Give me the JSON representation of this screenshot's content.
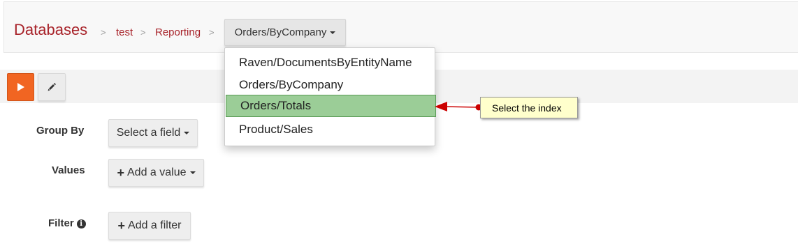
{
  "header": {
    "brand": "Databases",
    "breadcrumb": [
      {
        "label": "test"
      },
      {
        "label": "Reporting"
      }
    ],
    "separator": ">",
    "index_selector": {
      "label": "Orders/ByCompany"
    }
  },
  "dropdown": {
    "items": [
      {
        "label": "Raven/DocumentsByEntityName",
        "highlighted": false
      },
      {
        "label": "Orders/ByCompany",
        "highlighted": false
      },
      {
        "label": "Orders/Totals",
        "highlighted": true
      },
      {
        "label": "Product/Sales",
        "highlighted": false
      }
    ],
    "highlight_color": "#9bcd97"
  },
  "toolbar": {
    "run_icon": "play-icon",
    "edit_icon": "pencil-icon",
    "run_color": "#f16522"
  },
  "form": {
    "group_by": {
      "label": "Group By",
      "button": "Select a field"
    },
    "values": {
      "label": "Values",
      "button": "Add a value"
    },
    "filter": {
      "label": "Filter",
      "button": "Add a filter",
      "info_icon": "i"
    }
  },
  "annotation": {
    "text": "Select the index",
    "arrow_color": "#cc0000"
  },
  "colors": {
    "brand": "#a8232a"
  }
}
